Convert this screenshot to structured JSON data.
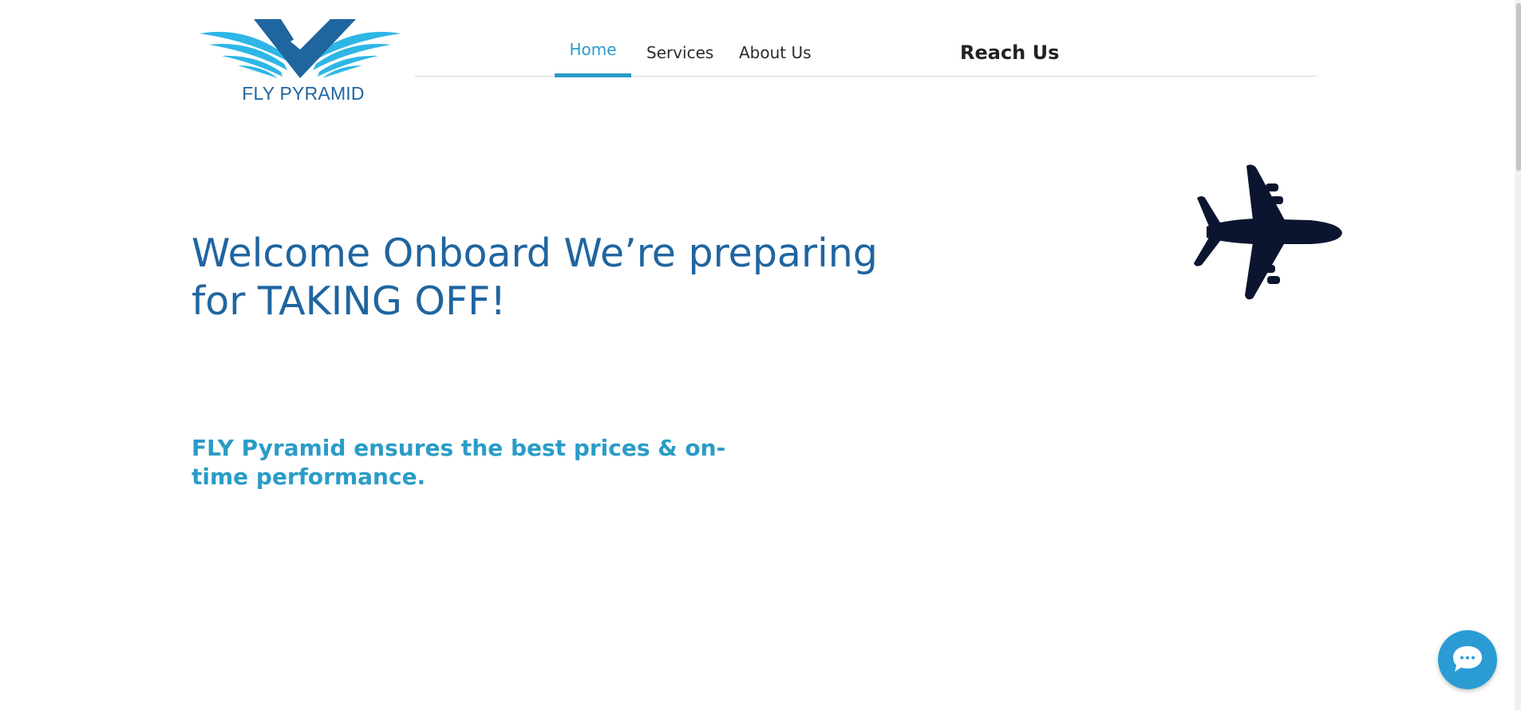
{
  "logo": {
    "text": "FLY PYRAMID",
    "icon": "wings-v-logo-icon",
    "colors": {
      "dark": "#1f65a0",
      "light": "#2eb6e6"
    }
  },
  "nav": {
    "items": [
      {
        "label": "Home",
        "active": true
      },
      {
        "label": "Services",
        "active": false
      },
      {
        "label": "About Us",
        "active": false
      }
    ],
    "reach_us": "Reach Us",
    "active_color": "#2a9cc7"
  },
  "hero": {
    "title": "Welcome Onboard We’re preparing for TAKING OFF!",
    "subtitle": "FLY Pyramid ensures the best prices & on-time performance.",
    "image_icon": "airplane-icon",
    "title_color": "#1f65a0",
    "subtitle_color": "#2a9cc7"
  },
  "chat": {
    "icon": "chat-bubble-icon",
    "color": "#2a9cd3"
  }
}
